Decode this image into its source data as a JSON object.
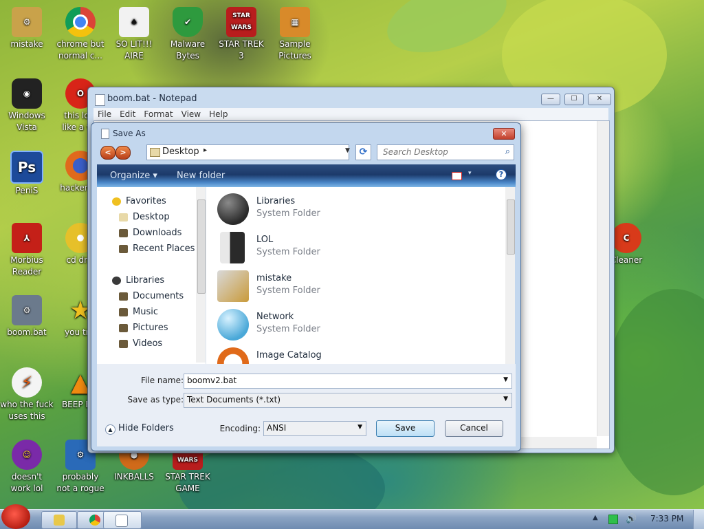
{
  "desktop_icons": [
    {
      "label": "mistake",
      "icon": "folder-tools-icon",
      "color": "#c9a24a"
    },
    {
      "label": "chrome but\nnormal c...",
      "icon": "chrome-icon",
      "color": "#2a7fd6"
    },
    {
      "label": "SO LIT!!!\nAIRE",
      "icon": "cards-icon",
      "color": "#e8e8e8"
    },
    {
      "label": "Malware\nBytes",
      "icon": "shield-icon",
      "color": "#2e9a3e"
    },
    {
      "label": "STAR TREK\n3",
      "icon": "star-wars-icon",
      "color": "#b81d1d"
    },
    {
      "label": "Sample\nPictures",
      "icon": "pictures-folder-icon",
      "color": "#d88a2a"
    },
    {
      "label": "Windows\nVista",
      "icon": "vista-icon",
      "color": "#222222"
    },
    {
      "label": "this lo...\nlike a v...",
      "icon": "opera-icon",
      "color": "#d82418"
    },
    {
      "label": "PeniS",
      "icon": "photoshop-icon",
      "color": "#1d4a9a"
    },
    {
      "label": "hacker r...",
      "icon": "firefox-icon",
      "color": "#e06a1c"
    },
    {
      "label": "Morbius\nReader",
      "icon": "pdf-reader-icon",
      "color": "#c42018"
    },
    {
      "label": "cd dr...",
      "icon": "cd-icon",
      "color": "#e6c02a"
    },
    {
      "label": "boom.bat",
      "icon": "batch-file-icon",
      "color": "#6b7a8c"
    },
    {
      "label": "you tr...",
      "icon": "star-icon",
      "color": "#f0c020"
    },
    {
      "label": "who the fuck\nuses this",
      "icon": "winamp-icon",
      "color": "#e05a10"
    },
    {
      "label": "BEEP B...",
      "icon": "vlc-icon",
      "color": "#f08a10"
    },
    {
      "label": "doesn't\nwork lol",
      "icon": "yahoo-messenger-icon",
      "color": "#7a2aa8"
    },
    {
      "label": "probably\nnot a rogue",
      "icon": "system-gears-icon",
      "color": "#2a6ab8"
    },
    {
      "label": "INKBALLS",
      "icon": "inkball-icon",
      "color": "#d06a1a"
    },
    {
      "label": "STAR TREK\nGAME",
      "icon": "star-wars-game-icon",
      "color": "#b81d1d"
    },
    {
      "label": "Cleaner",
      "icon": "ccleaner-icon",
      "color": "#d83a1a"
    }
  ],
  "notepad": {
    "title": "boom.bat - Notepad",
    "menu": [
      "File",
      "Edit",
      "Format",
      "View",
      "Help"
    ],
    "controls": {
      "minimize": "—",
      "maximize": "☐",
      "close": "✕"
    }
  },
  "save_as": {
    "title": "Save As",
    "close": "✕",
    "back": "<",
    "forward": ">",
    "address": "Desktop",
    "address_sep": "▸",
    "refresh": "⟳",
    "search_placeholder": "Search Desktop",
    "toolbar": {
      "organize": "Organize",
      "new_folder": "New folder",
      "dropdown": "▾",
      "help": "?"
    },
    "nav": {
      "favorites": {
        "label": "Favorites",
        "items": [
          "Desktop",
          "Downloads",
          "Recent Places"
        ]
      },
      "libraries": {
        "label": "Libraries",
        "items": [
          "Documents",
          "Music",
          "Pictures",
          "Videos"
        ]
      }
    },
    "files": [
      {
        "name": "Libraries",
        "type": "System Folder",
        "icon": "libraries-icon",
        "color": "#3a3a3a"
      },
      {
        "name": "LOL",
        "type": "System Folder",
        "icon": "user-folder-icon",
        "color": "#4a4a4a"
      },
      {
        "name": "mistake",
        "type": "System Folder",
        "icon": "computer-tools-icon",
        "color": "#c99a3a"
      },
      {
        "name": "Network",
        "type": "System Folder",
        "icon": "network-globe-icon",
        "color": "#4aa8d8"
      },
      {
        "name": "Image Catalog",
        "type": "",
        "icon": "image-catalog-icon",
        "color": "#e06a1a"
      }
    ],
    "file_name_label": "File name:",
    "file_name_value": "boomv2.bat",
    "save_as_type_label": "Save as type:",
    "save_as_type_value": "Text Documents (*.txt)",
    "encoding_label": "Encoding:",
    "encoding_value": "ANSI",
    "hide_folders": "Hide Folders",
    "save_button": "Save",
    "cancel_button": "Cancel"
  },
  "taskbar": {
    "clock": "7:33 PM",
    "tray_arrow": "▲",
    "volume": "🔊"
  }
}
